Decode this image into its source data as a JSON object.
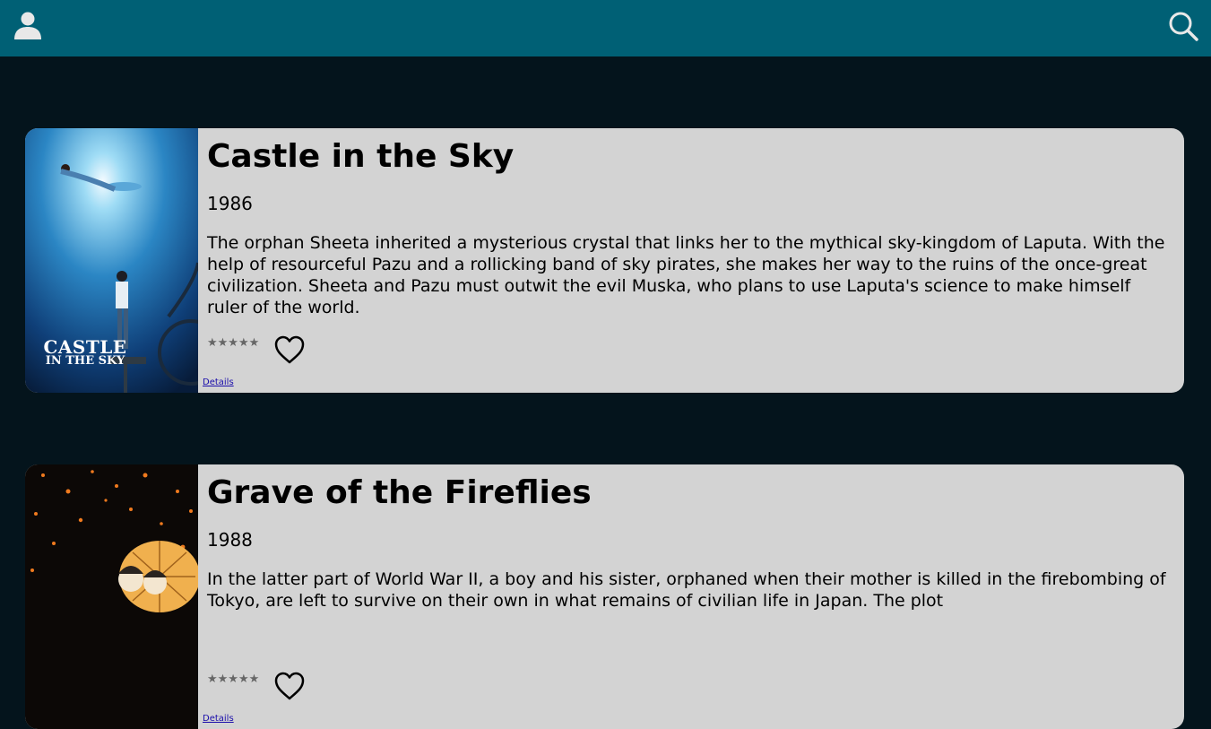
{
  "header": {
    "user_icon": "user-icon",
    "search_icon": "search-icon",
    "background_color": "#006075"
  },
  "page": {
    "background_color": "#04141c"
  },
  "movies": [
    {
      "title": "Castle in the Sky",
      "year": "1986",
      "description": "The orphan Sheeta inherited a mysterious crystal that links her to the mythical sky-kingdom of Laputa. With the help of resourceful Pazu and a rollicking band of sky pirates, she makes her way to the ruins of the once-great civilization. Sheeta and Pazu must outwit the evil Muska, who plans to use Laputa's science to make himself ruler of the world.",
      "stars": "★★★★★",
      "favorite_icon": "heart-outline-icon",
      "details_label": "Details",
      "poster_text_line1": "CASTLE",
      "poster_text_line2": "IN THE SKY"
    },
    {
      "title": "Grave of the Fireflies",
      "year": "1988",
      "description": "In the latter part of World War II, a boy and his sister, orphaned when their mother is killed in the firebombing of Tokyo, are left to survive on their own in what remains of civilian life in Japan. The plot",
      "stars": "★★★★★",
      "favorite_icon": "heart-outline-icon",
      "details_label": "Details"
    }
  ]
}
